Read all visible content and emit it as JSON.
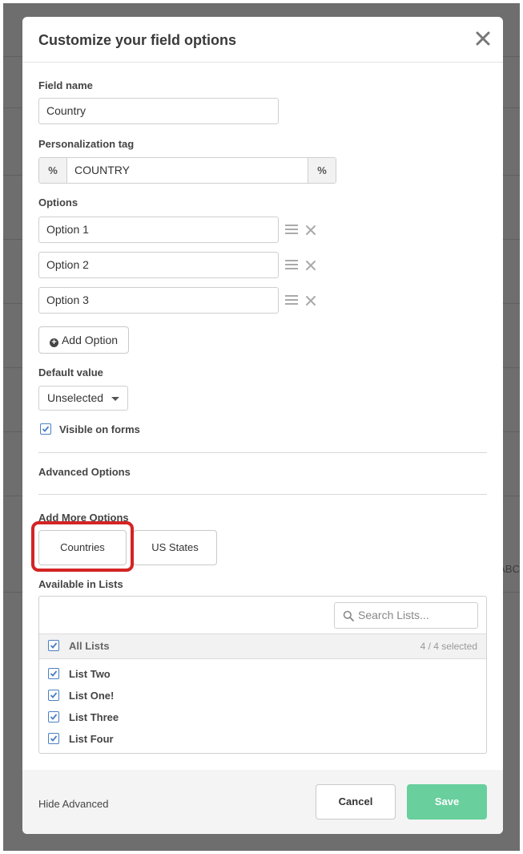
{
  "modal": {
    "title": "Customize your field options",
    "close_icon": "close-icon"
  },
  "field_name": {
    "label": "Field name",
    "value": "Country"
  },
  "personalization": {
    "label": "Personalization tag",
    "prefix": "%",
    "value": "COUNTRY",
    "suffix": "%"
  },
  "options": {
    "label": "Options",
    "items": [
      {
        "value": "Option 1"
      },
      {
        "value": "Option 2"
      },
      {
        "value": "Option 3"
      }
    ],
    "add_label": "Add Option"
  },
  "default_value": {
    "label": "Default value",
    "selected": "Unselected"
  },
  "visible_on_forms": {
    "label": "Visible on forms",
    "checked": true
  },
  "advanced_options": {
    "label": "Advanced Options"
  },
  "add_more": {
    "label": "Add More Options",
    "buttons": [
      {
        "label": "Countries"
      },
      {
        "label": "US States"
      }
    ]
  },
  "lists": {
    "label": "Available in Lists",
    "search_placeholder": "Search Lists...",
    "all_label": "All Lists",
    "count": "4 / 4 selected",
    "items": [
      {
        "label": "List Two",
        "checked": true
      },
      {
        "label": "List One!",
        "checked": true
      },
      {
        "label": "List Three",
        "checked": true
      },
      {
        "label": "List Four",
        "checked": true
      }
    ]
  },
  "footer": {
    "hide_advanced": "Hide Advanced",
    "cancel": "Cancel",
    "save": "Save"
  },
  "background": {
    "partial_text": "ABC"
  },
  "colors": {
    "accent": "#4a7fc4",
    "save": "#68cf9d",
    "highlight": "#d42424"
  }
}
